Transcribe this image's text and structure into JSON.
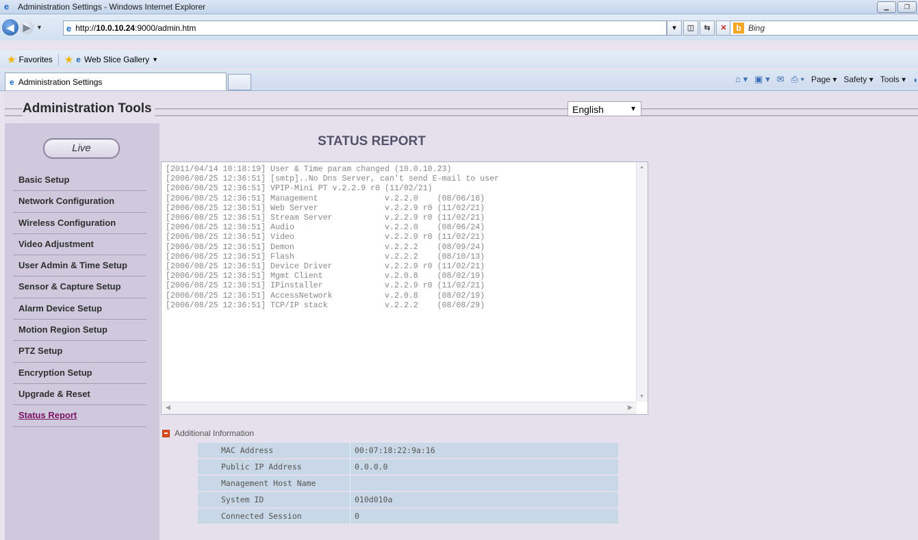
{
  "window": {
    "title": "Administration Settings - Windows Internet Explorer"
  },
  "address": {
    "url_prefix": "http://",
    "url_host": "10.0.10.24",
    "url_suffix": ":9000/admin.htm",
    "search_placeholder": "Bing"
  },
  "favorites": {
    "favorites_label": "Favorites",
    "web_slice_label": "Web Slice Gallery"
  },
  "tabs": {
    "active_label": "Administration Settings"
  },
  "commandbar": {
    "page_label": "Page",
    "safety_label": "Safety",
    "tools_label": "Tools"
  },
  "header": {
    "title": "Administration Tools",
    "language": "English"
  },
  "sidebar": {
    "live_label": "Live",
    "items": [
      {
        "label": "Basic Setup"
      },
      {
        "label": "Network Configuration"
      },
      {
        "label": "Wireless Configuration"
      },
      {
        "label": "Video Adjustment"
      },
      {
        "label": "User Admin & Time Setup"
      },
      {
        "label": "Sensor & Capture Setup"
      },
      {
        "label": "Alarm Device Setup"
      },
      {
        "label": "Motion Region Setup"
      },
      {
        "label": "PTZ Setup"
      },
      {
        "label": "Encryption Setup"
      },
      {
        "label": "Upgrade & Reset"
      },
      {
        "label": "Status Report"
      }
    ]
  },
  "main": {
    "title": "STATUS REPORT",
    "log_lines": [
      "[2011/04/14 10:18:19] User & Time param changed (10.0.10.23)",
      "[2006/08/25 12:36:51] [smtp]..No Dns Server, can't send E-mail to user",
      "[2006/08/25 12:36:51] VPIP-Mini PT v.2.2.9 r0 (11/02/21)",
      "[2006/08/25 12:36:51] Management              v.2.2.0    (08/06/16)",
      "[2006/08/25 12:36:51] Web Server              v.2.2.9 r0 (11/02/21)",
      "[2006/08/25 12:36:51] Stream Server           v.2.2.9 r0 (11/02/21)",
      "[2006/08/25 12:36:51] Audio                   v.2.2.0    (08/06/24)",
      "[2006/08/25 12:36:51] Video                   v.2.2.9 r0 (11/02/21)",
      "[2006/08/25 12:36:51] Demon                   v.2.2.2    (08/09/24)",
      "[2006/08/25 12:36:51] Flash                   v.2.2.2    (08/10/13)",
      "[2006/08/25 12:36:51] Device Driver           v.2.2.9 r0 (11/02/21)",
      "[2006/08/25 12:36:51] Mgmt Client             v.2.0.8    (08/02/19)",
      "[2006/08/25 12:36:51] IPinstaller             v.2.2.9 r0 (11/02/21)",
      "[2006/08/25 12:36:51] AccessNetwork           v.2.0.8    (08/02/19)",
      "[2006/08/25 12:36:51] TCP/IP stack            v.2.2.2    (08/08/29)"
    ],
    "additional_label": "Additional Information",
    "info": [
      {
        "label": "MAC Address",
        "value": "00:07:18:22:9a:16"
      },
      {
        "label": "Public IP Address",
        "value": "0.0.0.0"
      },
      {
        "label": "Management Host Name",
        "value": ""
      },
      {
        "label": "System ID",
        "value": "010d010a"
      },
      {
        "label": "Connected Session",
        "value": "0"
      }
    ]
  }
}
